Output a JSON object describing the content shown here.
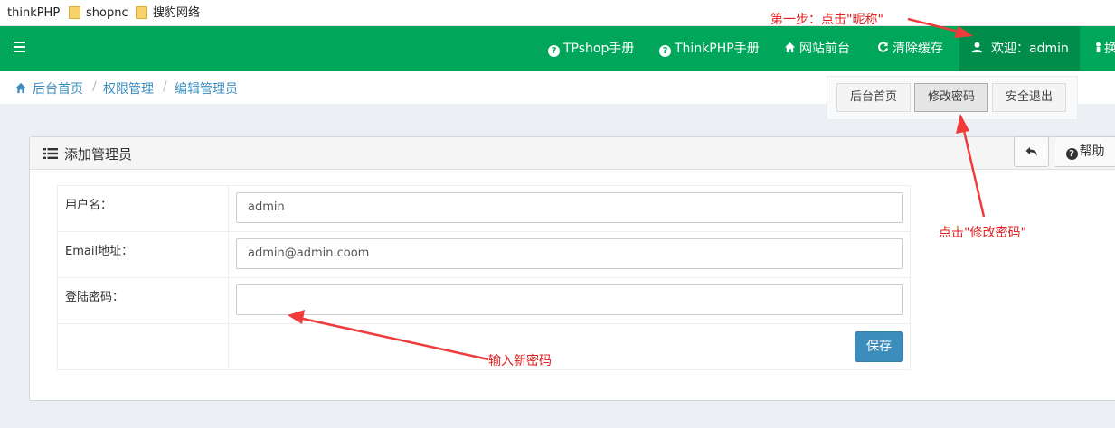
{
  "bookmarks": [
    "thinkPHP",
    "shopnc",
    "搜豹网络"
  ],
  "header": {
    "nav": [
      {
        "label": "TPshop手册",
        "icon": "question-circle-icon"
      },
      {
        "label": "ThinkPHP手册",
        "icon": "question-circle-icon"
      },
      {
        "label": "网站前台",
        "icon": "home-icon"
      },
      {
        "label": "清除缓存",
        "icon": "refresh-icon"
      }
    ],
    "user_label": "欢迎：admin",
    "cut_label": "换"
  },
  "breadcrumb": [
    "后台首页",
    "权限管理",
    "编辑管理员"
  ],
  "dropdown": [
    "后台首页",
    "修改密码",
    "安全退出"
  ],
  "box": {
    "title": "添加管理员",
    "help_label": "帮助"
  },
  "form": {
    "username_label": "用户名：",
    "username_value": "admin",
    "email_label": "Email地址：",
    "email_value": "admin@admin.coom",
    "password_label": "登陆密码：",
    "password_value": "",
    "save_label": "保存"
  },
  "annotations": {
    "step1": "第一步：点击\"昵称\"",
    "change_pwd": "点击\"修改密码\"",
    "new_pwd": "输入新密码"
  },
  "colors": {
    "header_green": "#00a65a",
    "user_green": "#008d4c",
    "link_blue": "#3c8dbc",
    "annotation_red": "#e02020"
  }
}
